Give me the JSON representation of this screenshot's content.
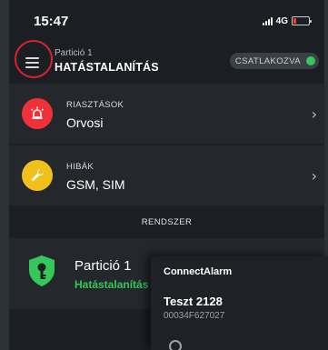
{
  "status_bar": {
    "time": "15:47",
    "network": "4G"
  },
  "header": {
    "partition_label": "Partició 1",
    "state": "HATÁSTALANÍTÁS",
    "connection_status": "CSATLAKOZVA",
    "connection_color": "#34c759"
  },
  "alarms": {
    "caption": "RIASZTÁSOK",
    "value": "Orvosi",
    "icon": "alarm-siren-icon",
    "color": "#f0313a"
  },
  "faults": {
    "caption": "HIBÁK",
    "value": "GSM, SIM",
    "icon": "wrench-icon",
    "color": "#f2c01c"
  },
  "section": {
    "title": "RENDSZER"
  },
  "partition": {
    "name": "Partició 1",
    "state": "Hatástalanítás",
    "icon": "shield-key-icon",
    "state_color": "#34c759"
  },
  "popup": {
    "app_name": "ConnectAlarm",
    "title": "Teszt 2128",
    "device_id": "00034F627027"
  }
}
